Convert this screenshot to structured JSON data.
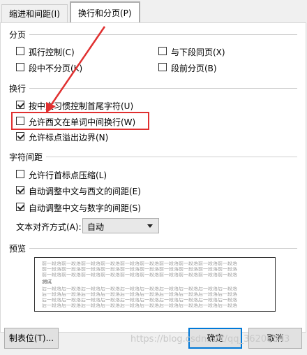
{
  "tabs": [
    {
      "label": "缩进和间距(I)"
    },
    {
      "label": "换行和分页(P)"
    }
  ],
  "pagination": {
    "title": "分页",
    "widow_control": "孤行控制(C)",
    "keep_with_next": "与下段同页(X)",
    "keep_lines_together": "段中不分页(K)",
    "page_break_before": "段前分页(B)"
  },
  "line_break": {
    "title": "换行",
    "kinsoku": "按中文习惯控制首尾字符(U)",
    "allow_break_in_word": "允许西文在单词中间换行(W)",
    "allow_punct_overflow": "允许标点溢出边界(N)"
  },
  "char_spacing": {
    "title": "字符间距",
    "compress_punct": "允许行首标点压缩(L)",
    "auto_space_cn_en": "自动调整中文与西文的间距(E)",
    "auto_space_cn_num": "自动调整中文与数字的间距(S)",
    "alignment_label": "文本对齐方式(A):",
    "alignment_value": "自动"
  },
  "preview": {
    "title": "预览",
    "prev_text": "前一段落前一段落前一段落前一段落前一段落前一段落前一段落前一段落前一段落前一段落",
    "sample_text": "测试",
    "next_text": "后一段落后一段落后一段落后一段落后一段落后一段落后一段落后一段落后一段落后一段落"
  },
  "buttons": {
    "tabs_button": "制表位(T)...",
    "ok": "确定",
    "cancel": "取消"
  },
  "watermark": "https://blog.csdn.net/qq_36208543",
  "colors": {
    "highlight": "#e03030",
    "accent": "#0078d7"
  }
}
